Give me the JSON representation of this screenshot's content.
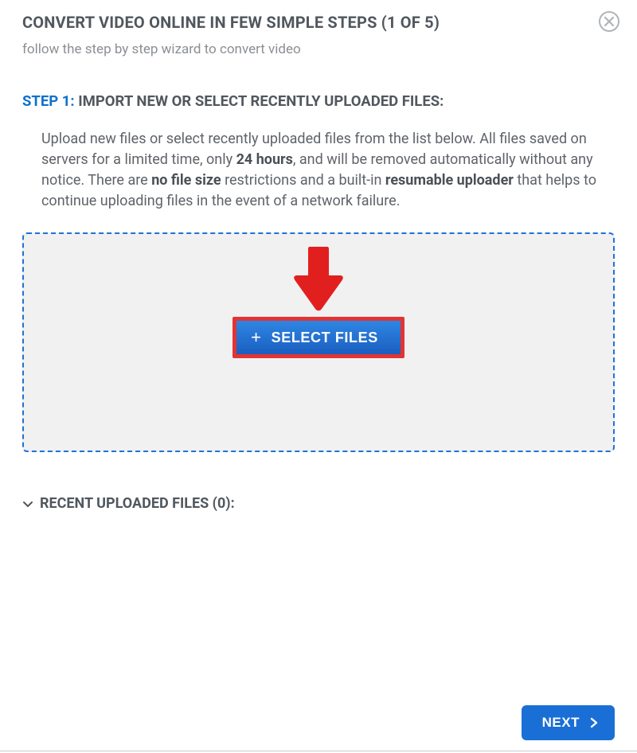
{
  "header": {
    "title": "CONVERT VIDEO ONLINE IN FEW SIMPLE STEPS (1 OF 5)",
    "subtitle": "follow the step by step wizard to convert video"
  },
  "step": {
    "label": "STEP 1:",
    "heading": "IMPORT NEW OR SELECT RECENTLY UPLOADED FILES:"
  },
  "paragraph": {
    "pre1": "Upload new files or select recently uploaded files from the list below. All files saved on servers for a limited time, only ",
    "b1": "24 hours",
    "mid1": ", and will be removed automatically without any notice. There are ",
    "b2": "no file size",
    "mid2": " restrictions and a built-in ",
    "b3": "resumable uploader",
    "post": " that helps to continue uploading files in the event of a network failure."
  },
  "dropzone": {
    "select_label": "SELECT FILES"
  },
  "recent": {
    "label": "RECENT UPLOADED FILES (0):"
  },
  "footer": {
    "next_label": "NEXT"
  }
}
